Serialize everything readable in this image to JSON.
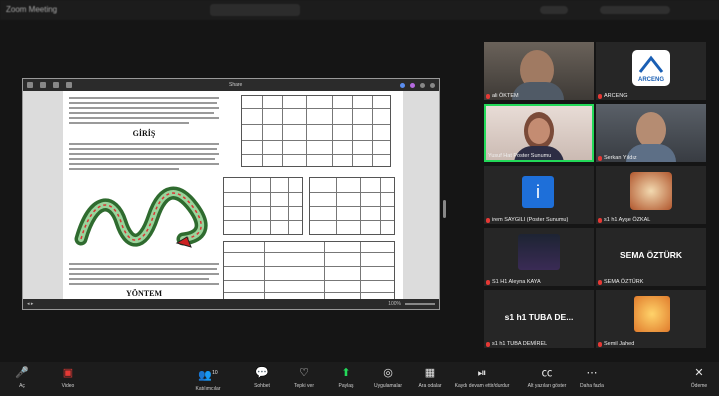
{
  "window": {
    "title": "Zoom Meeting",
    "control": "View"
  },
  "shared_document": {
    "heading_intro": "GİRİŞ",
    "heading_method": "YÖNTEM",
    "toolbar_title": "Share",
    "zoom_level": "100%"
  },
  "participants": [
    {
      "name": "ali ÖKTEM",
      "kind": "video"
    },
    {
      "name": "ARCENG",
      "kind": "logo",
      "logo_text": "ARCENG"
    },
    {
      "name": "Yusuf Hat Poster Sunumu",
      "kind": "video"
    },
    {
      "name": "Serkan Yıldız",
      "kind": "video"
    },
    {
      "name": "irem SAYGILI (Poster Sunumu)",
      "kind": "icon"
    },
    {
      "name": "s1 h1 Ayşe ÖZKAL",
      "kind": "image"
    },
    {
      "name": "S1 H1 Aleyna KAYA",
      "kind": "image"
    },
    {
      "name": "SEMA ÖZTÜRK",
      "kind": "text",
      "display": "SEMA ÖZTÜRK"
    },
    {
      "name": "s1 h1 TUBA DEMİREL",
      "kind": "text",
      "display": "s1 h1 TUBA DE..."
    },
    {
      "name": "Semil Jahed",
      "kind": "image"
    }
  ],
  "toolbar": {
    "mute": "Aç",
    "video": "Video",
    "participants": "Katılımcılar",
    "participants_count": "10",
    "chat": "Sohbet",
    "react": "Tepki ver",
    "share": "Paylaş",
    "apps": "Uygulamalar",
    "view": "Ara odalar",
    "record": "Kaydı devam ettir/durdur",
    "captions": "Alt yazıları göster",
    "more": "Daha fazla",
    "leave": "Ödeme"
  },
  "colors": {
    "accent": "#0e72ed",
    "muted": "#e53935",
    "active_speaker": "#23d959",
    "share": "#23d959"
  }
}
